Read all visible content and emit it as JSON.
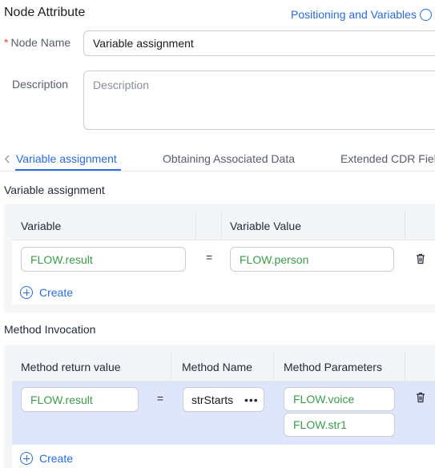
{
  "header": {
    "title": "Node Attribute",
    "positioning_link": "Positioning and Variables"
  },
  "form": {
    "node_name_label": "Node Name",
    "node_name_value": "Variable assignment",
    "description_label": "Description",
    "description_placeholder": "Description"
  },
  "tabs": [
    {
      "label": "Variable assignment",
      "active": true
    },
    {
      "label": "Obtaining Associated Data",
      "active": false
    },
    {
      "label": "Extended CDR Fiel",
      "active": false
    }
  ],
  "variable_section": {
    "title": "Variable assignment",
    "columns": [
      "Variable",
      "Variable Value"
    ],
    "rows": [
      {
        "variable": "FLOW.result",
        "operator": "=",
        "value": "FLOW.person"
      }
    ],
    "create_label": "Create"
  },
  "method_section": {
    "title": "Method Invocation",
    "columns": [
      "Method return value",
      "Method Name",
      "Method Parameters"
    ],
    "rows": [
      {
        "return_value": "FLOW.result",
        "operator": "=",
        "method_name": "strStarts",
        "more": "•••",
        "parameters": [
          "FLOW.voice",
          "FLOW.str1"
        ]
      }
    ],
    "create_label": "Create"
  },
  "colors": {
    "accent": "#2a6ce0",
    "variable_text": "#3c9a4a",
    "required": "#e5493a",
    "selected_row": "#dfe6fb"
  },
  "icons": [
    "info-circle-icon",
    "chevron-left-icon",
    "trash-icon",
    "plus-circle-icon",
    "more-icon"
  ]
}
